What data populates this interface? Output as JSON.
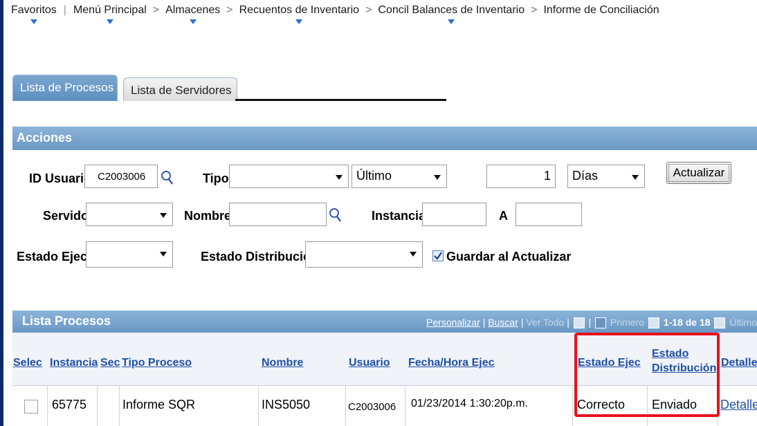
{
  "breadcrumb": {
    "items": [
      "Favoritos",
      "Menú Principal",
      "Almacenes",
      "Recuentos de Inventario",
      "Concil Balances de Inventario",
      "Informe de Conciliación"
    ],
    "separator": ">"
  },
  "tabs": [
    {
      "label": "Lista de Procesos"
    },
    {
      "label": "Lista de Servidores"
    }
  ],
  "acciones": {
    "title": "Acciones",
    "id_usuario": {
      "label": "ID Usuario",
      "value": "C2003006"
    },
    "tipo": {
      "label": "Tipo",
      "value": ""
    },
    "ultimo": {
      "value": "Último"
    },
    "cantidad": {
      "value": "1"
    },
    "unidad": {
      "value": "Días"
    },
    "actualizar_button": "Actualizar",
    "servidor": {
      "label": "Servidor",
      "value": ""
    },
    "nombre": {
      "label": "Nombre",
      "value": ""
    },
    "instancia": {
      "label": "Instancia",
      "value": ""
    },
    "a": {
      "label": "A",
      "value": ""
    },
    "estado_ejec": {
      "label": "Estado Ejec",
      "value": ""
    },
    "estado_distribucion": {
      "label": "Estado Distribución",
      "value": ""
    },
    "guardar": {
      "label": "Guardar al Actualizar",
      "checked": true
    }
  },
  "lista": {
    "title": "Lista Procesos",
    "personalizar": "Personalizar",
    "buscar": "Buscar",
    "ver_todo": "Ver Todo",
    "primero": "Primero",
    "range": "1-18 de 18",
    "ultimo": "Último",
    "columns": [
      "Selec",
      "Instancia",
      "Sec",
      "Tipo Proceso",
      "Nombre",
      "Usuario",
      "Fecha/Hora Ejec",
      "Estado Ejec",
      "Estado Distribución",
      "Detalles"
    ],
    "rows": [
      {
        "instancia": "65775",
        "sec": "",
        "tipo": "Informe SQR",
        "nombre": "INS5050",
        "usuario": "C2003006",
        "fecha": "01/23/2014  1:30:20p.m.",
        "estado": "Correcto",
        "distribucion": "Enviado",
        "detalles": "Detalles"
      }
    ]
  },
  "colors": {
    "header_blue": "#7aa7cf",
    "link": "#1f4fa6",
    "highlight": "#e8101e"
  }
}
